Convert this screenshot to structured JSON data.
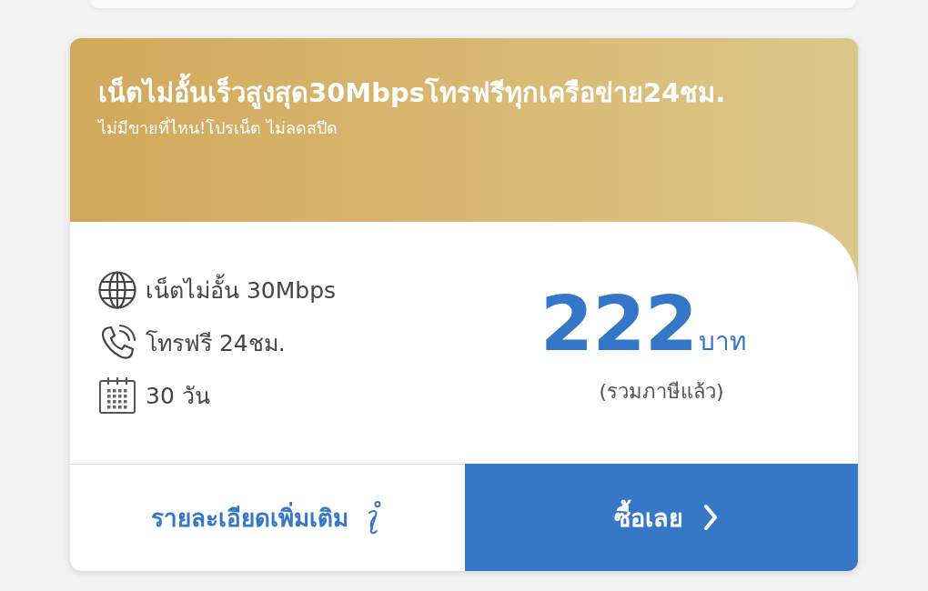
{
  "header": {
    "title": "เน็ตไม่อั้นเร็วสูงสุด30Mbpsโทรฟรีทุกเครือข่าย24ชม.",
    "subtitle": "ไม่มีขายที่ไหน!โปรเน็ต ไม่ลดสปีด"
  },
  "features": [
    {
      "kind": "internet",
      "text": "เน็ตไม่อั้น 30Mbps"
    },
    {
      "kind": "call",
      "text": "โทรฟรี 24ชม."
    },
    {
      "kind": "days",
      "text": "30 วัน"
    }
  ],
  "price": {
    "amount": "222",
    "unit": "บาท",
    "note": "(รวมภาษีแล้ว)"
  },
  "buttons": {
    "details": "รายละเอียดเพิ่มเติม",
    "buy": "ซื้อเลย"
  }
}
